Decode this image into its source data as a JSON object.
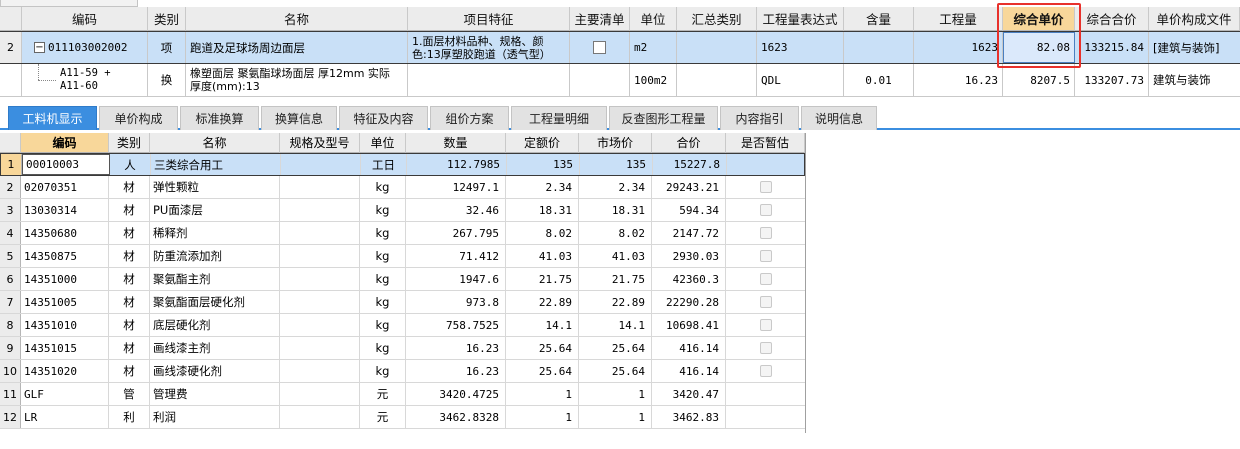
{
  "top_grid": {
    "headers": [
      "编码",
      "类别",
      "名称",
      "项目特征",
      "主要清单",
      "单位",
      "汇总类别",
      "工程量表达式",
      "含量",
      "工程量",
      "综合单价",
      "综合合价",
      "单价构成文件"
    ],
    "row1": {
      "row_no": "2",
      "expander": "−",
      "code": "011103002002",
      "type": "项",
      "name": "跑道及足球场周边面层",
      "feature_line1": "1.面层材料品种、规格、颜",
      "feature_line2": "色:13厚塑胶跑道（透气型）",
      "unit": "m2",
      "expression": "1623",
      "quantity": "1623",
      "unit_price": "82.08",
      "total": "133215.84",
      "price_file": "[建筑与装饰]"
    },
    "row2": {
      "code_line1": "A11-59 +",
      "code_line2": "A11-60",
      "type": "换",
      "name_line1": "橡塑面层 聚氨酯球场面层 厚12mm  实际",
      "name_line2": "厚度(mm):13",
      "unit": "100m2",
      "expression": "QDL",
      "content": "0.01",
      "quantity": "16.23",
      "unit_price": "8207.5",
      "total": "133207.73",
      "price_file": "建筑与装饰"
    },
    "highlight_color": "#e8312b"
  },
  "tabs": [
    "工料机显示",
    "单价构成",
    "标准换算",
    "换算信息",
    "特征及内容",
    "组价方案",
    "工程量明细",
    "反查图形工程量",
    "内容指引",
    "说明信息"
  ],
  "bottom_grid": {
    "headers": [
      "编码",
      "类别",
      "名称",
      "规格及型号",
      "单位",
      "数量",
      "定额价",
      "市场价",
      "合价",
      "是否暂估"
    ],
    "rows": [
      {
        "no": "1",
        "code": "00010003",
        "type": "人",
        "name": "三类综合用工",
        "spec": "",
        "unit": "工日",
        "qty": "112.7985",
        "quota": "135",
        "market": "135",
        "total": "15227.8",
        "est": false
      },
      {
        "no": "2",
        "code": "02070351",
        "type": "材",
        "name": "弹性颗粒",
        "spec": "",
        "unit": "kg",
        "qty": "12497.1",
        "quota": "2.34",
        "market": "2.34",
        "total": "29243.21",
        "est": true
      },
      {
        "no": "3",
        "code": "13030314",
        "type": "材",
        "name": "PU面漆层",
        "spec": "",
        "unit": "kg",
        "qty": "32.46",
        "quota": "18.31",
        "market": "18.31",
        "total": "594.34",
        "est": true
      },
      {
        "no": "4",
        "code": "14350680",
        "type": "材",
        "name": "稀释剂",
        "spec": "",
        "unit": "kg",
        "qty": "267.795",
        "quota": "8.02",
        "market": "8.02",
        "total": "2147.72",
        "est": true
      },
      {
        "no": "5",
        "code": "14350875",
        "type": "材",
        "name": "防重流添加剂",
        "spec": "",
        "unit": "kg",
        "qty": "71.412",
        "quota": "41.03",
        "market": "41.03",
        "total": "2930.03",
        "est": true
      },
      {
        "no": "6",
        "code": "14351000",
        "type": "材",
        "name": "聚氨酯主剂",
        "spec": "",
        "unit": "kg",
        "qty": "1947.6",
        "quota": "21.75",
        "market": "21.75",
        "total": "42360.3",
        "est": true
      },
      {
        "no": "7",
        "code": "14351005",
        "type": "材",
        "name": "聚氨酯面层硬化剂",
        "spec": "",
        "unit": "kg",
        "qty": "973.8",
        "quota": "22.89",
        "market": "22.89",
        "total": "22290.28",
        "est": true
      },
      {
        "no": "8",
        "code": "14351010",
        "type": "材",
        "name": "底层硬化剂",
        "spec": "",
        "unit": "kg",
        "qty": "758.7525",
        "quota": "14.1",
        "market": "14.1",
        "total": "10698.41",
        "est": true
      },
      {
        "no": "9",
        "code": "14351015",
        "type": "材",
        "name": "画线漆主剂",
        "spec": "",
        "unit": "kg",
        "qty": "16.23",
        "quota": "25.64",
        "market": "25.64",
        "total": "416.14",
        "est": true
      },
      {
        "no": "10",
        "code": "14351020",
        "type": "材",
        "name": "画线漆硬化剂",
        "spec": "",
        "unit": "kg",
        "qty": "16.23",
        "quota": "25.64",
        "market": "25.64",
        "total": "416.14",
        "est": true
      },
      {
        "no": "11",
        "code": "GLF",
        "type": "管",
        "name": "管理费",
        "spec": "",
        "unit": "元",
        "qty": "3420.4725",
        "quota": "1",
        "market": "1",
        "total": "3420.47",
        "est": false
      },
      {
        "no": "12",
        "code": "LR",
        "type": "利",
        "name": "利润",
        "spec": "",
        "unit": "元",
        "qty": "3462.8328",
        "quota": "1",
        "market": "1",
        "total": "3462.83",
        "est": false
      }
    ]
  }
}
